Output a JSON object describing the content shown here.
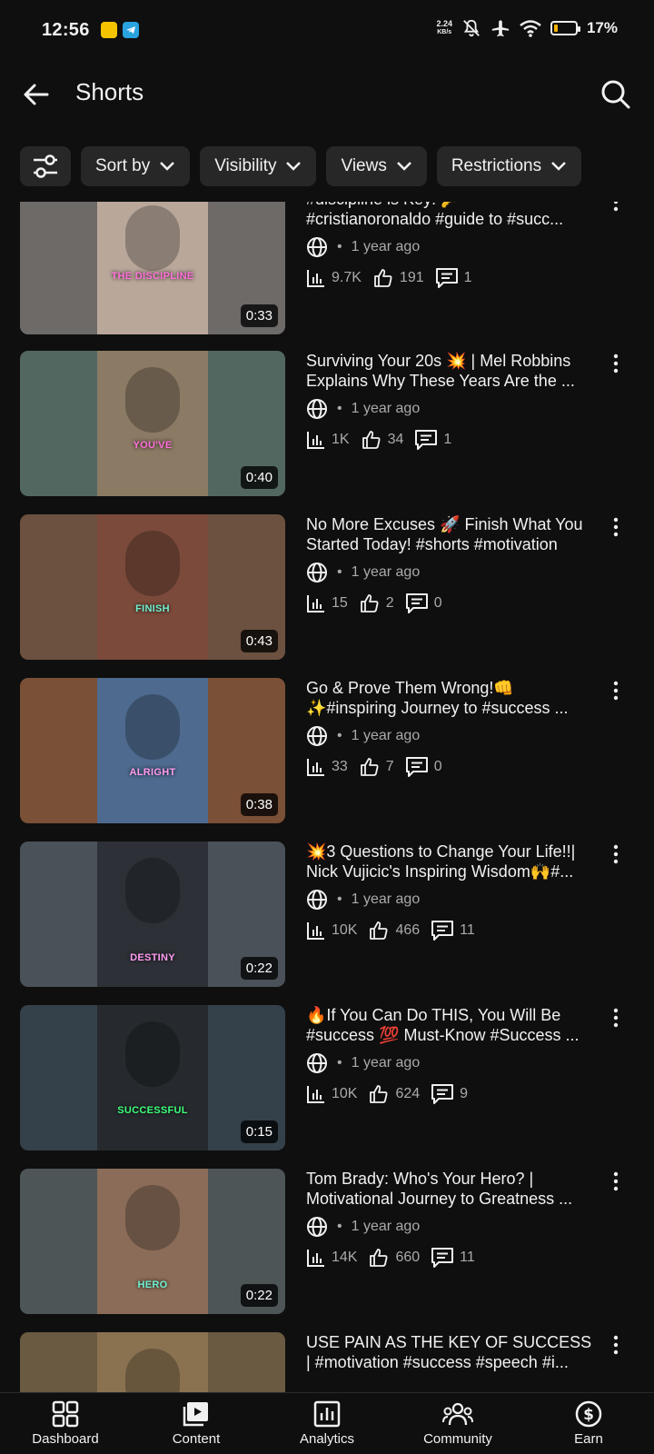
{
  "status_bar": {
    "time": "12:56",
    "net_speed_value": "2.24",
    "net_speed_unit": "KB/s",
    "battery_percent": "17%",
    "battery_level": 0.17,
    "battery_color": "#f4b400"
  },
  "header": {
    "title": "Shorts",
    "back_icon": "arrow-left-icon",
    "search_icon": "search-icon"
  },
  "filters": {
    "filter_icon": "sliders-icon",
    "chips": [
      "Sort by",
      "Visibility",
      "Views",
      "Restrictions"
    ]
  },
  "videos": [
    {
      "title_line1": "#discipline is Key! 🔑",
      "title_line2": "#cristianoronaldo  #guide to #succ...",
      "visibility_icon": "globe-icon",
      "age": "1 year ago",
      "views": "9.7K",
      "likes": "191",
      "comments": "1",
      "duration": "0:33",
      "caption": "THE DISCIPLINE",
      "caption_color": "#ff6fd8",
      "thumb_bg": "#6e6a68",
      "thumb_center_bg": "#b9a79a"
    },
    {
      "title_line1": "Surviving Your 20s 💥 | Mel Robbins",
      "title_line2": "Explains Why These Years Are the ...",
      "visibility_icon": "globe-icon",
      "age": "1 year ago",
      "views": "1K",
      "likes": "34",
      "comments": "1",
      "duration": "0:40",
      "caption": "YOU'VE",
      "caption_color": "#ff6fd8",
      "thumb_bg": "#536761",
      "thumb_center_bg": "#8b7a64"
    },
    {
      "title_line1": "No More Excuses 🚀  Finish What You",
      "title_line2": "Started Today! #shorts #motivation",
      "visibility_icon": "globe-icon",
      "age": "1 year ago",
      "views": "15",
      "likes": "2",
      "comments": "0",
      "duration": "0:43",
      "caption": "FINISH",
      "caption_color": "#6ff0d0",
      "thumb_bg": "#6c5140",
      "thumb_center_bg": "#7b4a3b"
    },
    {
      "title_line1": "Go & Prove Them Wrong!👊",
      "title_line2": "✨#inspiring Journey to #success ...",
      "visibility_icon": "globe-icon",
      "age": "1 year ago",
      "views": "33",
      "likes": "7",
      "comments": "0",
      "duration": "0:38",
      "caption": "ALRIGHT",
      "caption_color": "#ff9cf2",
      "thumb_bg": "#7a5036",
      "thumb_center_bg": "#4e6a8e"
    },
    {
      "title_line1": "💥3 Questions to Change Your Life!!|",
      "title_line2": "Nick Vujicic's Inspiring Wisdom🙌#...",
      "visibility_icon": "globe-icon",
      "age": "1 year ago",
      "views": "10K",
      "likes": "466",
      "comments": "11",
      "duration": "0:22",
      "caption": "DESTINY",
      "caption_color": "#ff9cf2",
      "thumb_bg": "#4a5158",
      "thumb_center_bg": "#2d3036"
    },
    {
      "title_line1": "🔥If You Can Do THIS, You Will Be",
      "title_line2": "#success 💯 Must-Know #Success ...",
      "visibility_icon": "globe-icon",
      "age": "1 year ago",
      "views": "10K",
      "likes": "624",
      "comments": "9",
      "duration": "0:15",
      "caption": "SUCCESSFUL",
      "caption_color": "#3dff7a",
      "thumb_bg": "#34404a",
      "thumb_center_bg": "#262a2e"
    },
    {
      "title_line1": "Tom Brady: Who's Your Hero? |",
      "title_line2": "Motivational Journey to Greatness ...",
      "visibility_icon": "globe-icon",
      "age": "1 year ago",
      "views": "14K",
      "likes": "660",
      "comments": "11",
      "duration": "0:22",
      "caption": "HERO",
      "caption_color": "#6ff0d0",
      "thumb_bg": "#4d5557",
      "thumb_center_bg": "#8a6c58"
    },
    {
      "title_line1": "USE PAIN AS THE KEY OF  SUCCESS",
      "title_line2": "| #motivation #success #speech #i...",
      "visibility_icon": "globe-icon",
      "age": "",
      "views": "",
      "likes": "",
      "comments": "",
      "duration": "",
      "caption": "",
      "caption_color": "#ffffff",
      "thumb_bg": "#6a5a42",
      "thumb_center_bg": "#8a7250"
    }
  ],
  "bottom_nav": [
    {
      "label": "Dashboard",
      "icon": "dashboard-icon"
    },
    {
      "label": "Content",
      "icon": "content-icon"
    },
    {
      "label": "Analytics",
      "icon": "analytics-icon"
    },
    {
      "label": "Community",
      "icon": "community-icon"
    },
    {
      "label": "Earn",
      "icon": "earn-icon"
    }
  ]
}
